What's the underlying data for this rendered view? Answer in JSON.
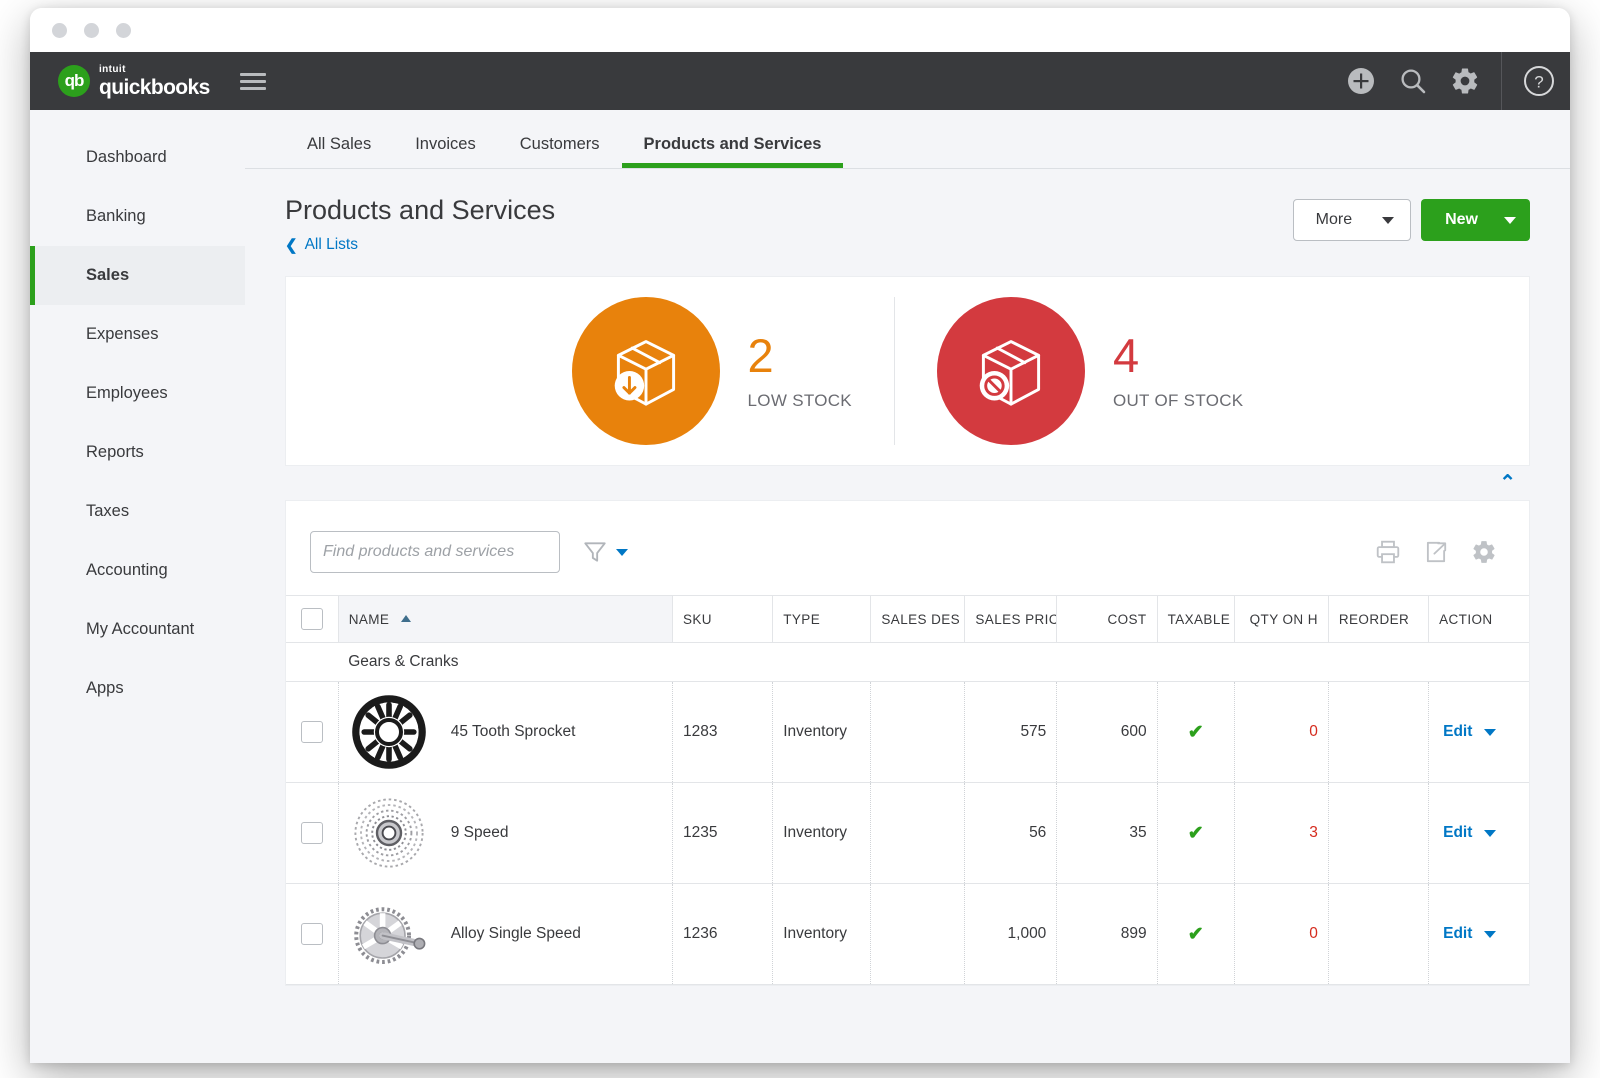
{
  "window": {
    "dots": [
      "close",
      "minimize",
      "maximize"
    ]
  },
  "topnav": {
    "logo": {
      "badge": "qb",
      "intuit": "intuit",
      "brand": "quickbooks"
    },
    "menu_icon": "hamburger-menu-icon",
    "icons": [
      "plus-circle-icon",
      "search-icon",
      "gear-icon",
      "help-circle-icon"
    ]
  },
  "sidebar": {
    "items": [
      {
        "label": "Dashboard",
        "active": false
      },
      {
        "label": "Banking",
        "active": false
      },
      {
        "label": "Sales",
        "active": true
      },
      {
        "label": "Expenses",
        "active": false
      },
      {
        "label": "Employees",
        "active": false
      },
      {
        "label": "Reports",
        "active": false
      },
      {
        "label": "Taxes",
        "active": false
      },
      {
        "label": "Accounting",
        "active": false
      },
      {
        "label": "My Accountant",
        "active": false
      },
      {
        "label": "Apps",
        "active": false
      }
    ]
  },
  "tabs": [
    {
      "label": "All Sales",
      "active": false
    },
    {
      "label": "Invoices",
      "active": false
    },
    {
      "label": "Customers",
      "active": false
    },
    {
      "label": "Products and Services",
      "active": true
    }
  ],
  "page": {
    "title": "Products and Services",
    "back_link": "All Lists",
    "more_button": "More",
    "new_button": "New"
  },
  "stats": {
    "low_stock": {
      "count": "2",
      "label": "LOW STOCK",
      "color": "#e8820c",
      "icon": "box-down-arrow-icon"
    },
    "out_of_stock": {
      "count": "4",
      "label": "OUT OF STOCK",
      "color": "#d33a3f",
      "icon": "box-prohibited-icon"
    }
  },
  "toolbar": {
    "search_placeholder": "Find products and services",
    "search_value": "",
    "filter_icon": "funnel-filter-icon",
    "print_icon": "printer-icon",
    "export_icon": "export-icon",
    "settings_icon": "gear-icon"
  },
  "table": {
    "columns": [
      "NAME",
      "SKU",
      "TYPE",
      "SALES DES",
      "SALES PRIC",
      "COST",
      "TAXABLE",
      "QTY ON H",
      "REORDER",
      "ACTION"
    ],
    "sort_column": "NAME",
    "sort_direction": "ascending",
    "group": "Gears & Cranks",
    "rows": [
      {
        "name": "45 Tooth Sprocket",
        "thumb": "sprocket-image",
        "sku": "1283",
        "type": "Inventory",
        "sales_description": "",
        "sales_price": "575",
        "cost": "600",
        "taxable": "✔",
        "qty_on_hand": "0",
        "reorder_point": "",
        "action": "Edit"
      },
      {
        "name": "9 Speed",
        "thumb": "cassette-image",
        "sku": "1235",
        "type": "Inventory",
        "sales_description": "",
        "sales_price": "56",
        "cost": "35",
        "taxable": "✔",
        "qty_on_hand": "3",
        "reorder_point": "",
        "action": "Edit"
      },
      {
        "name": "Alloy Single Speed",
        "thumb": "crankset-image",
        "sku": "1236",
        "type": "Inventory",
        "sales_description": "",
        "sales_price": "1,000",
        "cost": "899",
        "taxable": "✔",
        "qty_on_hand": "0",
        "reorder_point": "",
        "action": "Edit"
      }
    ]
  },
  "colors": {
    "brand_green": "#2ca01c",
    "link_blue": "#0077c5",
    "topnav_dark": "#393a3d",
    "orange": "#e8820c",
    "red": "#d33a3f",
    "qty_red": "#d52b1e"
  }
}
